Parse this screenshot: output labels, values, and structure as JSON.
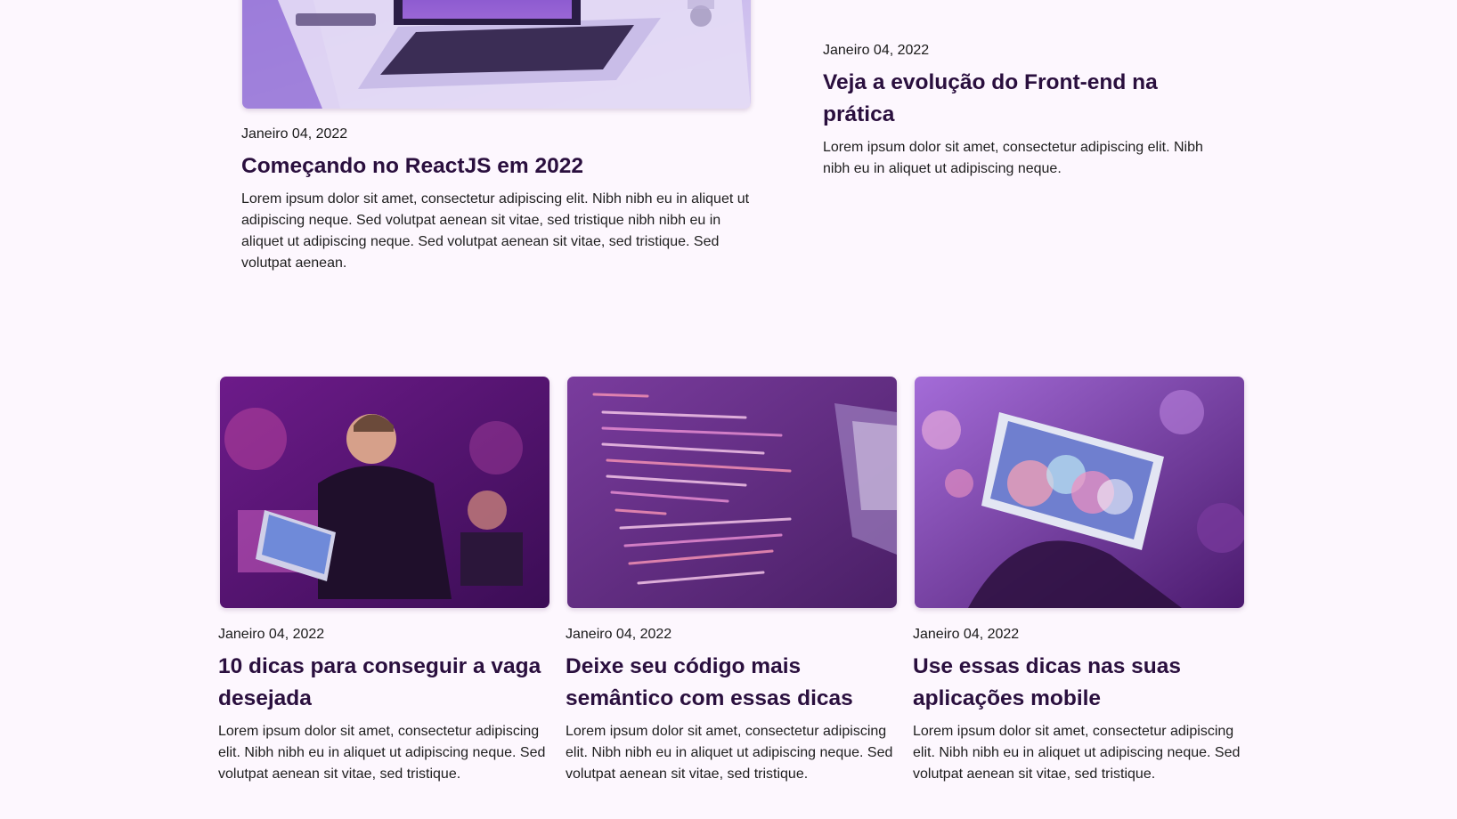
{
  "featured": [
    {
      "date": "Janeiro 04, 2022",
      "title": "Começando no ReactJS em 2022",
      "excerpt": "Lorem ipsum dolor sit amet, consectetur adipiscing elit. Nibh nibh eu in aliquet ut adipiscing neque. Sed volutpat aenean sit vitae, sed tristique nibh nibh eu in aliquet ut adipiscing neque. Sed volutpat aenean sit vitae, sed tristique. Sed volutpat aenean.",
      "image_icon": "laptop-desk-image"
    },
    {
      "date": "Janeiro 04, 2022",
      "title": "Veja a evolução do Front-end na prática",
      "excerpt": "Lorem ipsum dolor sit amet, consectetur adipiscing elit. Nibh nibh eu in aliquet ut adipiscing neque."
    }
  ],
  "posts": [
    {
      "date": "Janeiro 04, 2022",
      "title": "10 dicas para conseguir a vaga desejada",
      "excerpt": "Lorem ipsum dolor sit amet, consectetur adipiscing elit. Nibh nibh eu in aliquet ut adipiscing neque. Sed volutpat aenean sit vitae, sed tristique.",
      "image_icon": "person-laptop-image"
    },
    {
      "date": "Janeiro 04, 2022",
      "title": "Deixe seu código mais semântico com essas dicas",
      "excerpt": "Lorem ipsum dolor sit amet, consectetur adipiscing elit. Nibh nibh eu in aliquet ut adipiscing neque. Sed volutpat aenean sit vitae, sed tristique.",
      "image_icon": "code-screen-image"
    },
    {
      "date": "Janeiro 04, 2022",
      "title": "Use essas dicas nas suas aplicações mobile",
      "excerpt": "Lorem ipsum dolor sit amet, consectetur adipiscing elit. Nibh nibh eu in aliquet ut adipiscing neque. Sed volutpat aenean sit vitae, sed tristique.",
      "image_icon": "smartphone-bokeh-image"
    }
  ],
  "colors": {
    "background": "#fdf7fe",
    "title": "#2a0f3e",
    "accent": "#8a3fb3"
  }
}
